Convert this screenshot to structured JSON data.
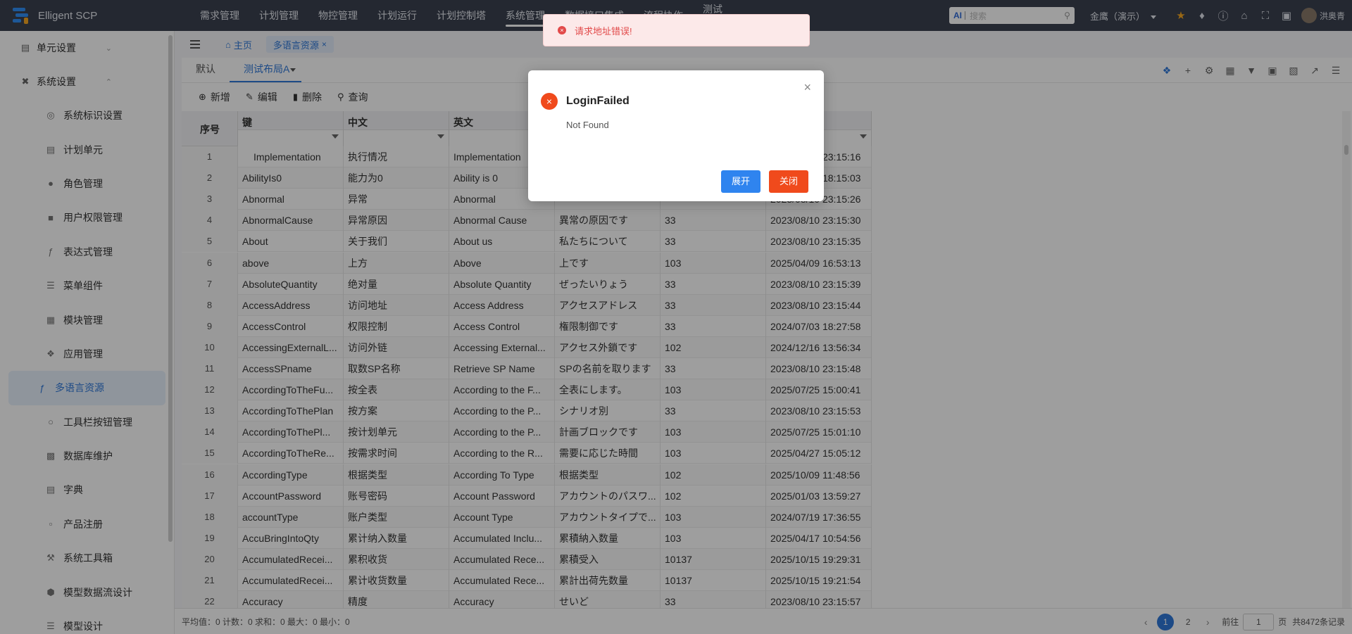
{
  "app": {
    "title": "Elligent SCP"
  },
  "topnav": [
    "需求管理",
    "计划管理",
    "物控管理",
    "计划运行",
    "计划控制塔",
    "系统管理",
    "数据接口集成",
    "流程协作",
    "测试"
  ],
  "topbar": {
    "search_placeholder": "搜索",
    "ai_label": "AI",
    "tenant": "金鹰（演示）",
    "user": "洪奥青"
  },
  "sidebar": {
    "groups": [
      {
        "label": "单元设置",
        "icon": "unit-icon"
      },
      {
        "label": "系统设置",
        "icon": "wrench-icon"
      }
    ],
    "items": [
      {
        "label": "系统标识设置",
        "icon": "target-icon"
      },
      {
        "label": "计划单元",
        "icon": "doc-icon"
      },
      {
        "label": "角色管理",
        "icon": "person-icon"
      },
      {
        "label": "用户权限管理",
        "icon": "lock-icon"
      },
      {
        "label": "表达式管理",
        "icon": "fx-icon"
      },
      {
        "label": "菜单组件",
        "icon": "list-icon"
      },
      {
        "label": "模块管理",
        "icon": "table-icon"
      },
      {
        "label": "应用管理",
        "icon": "apps-icon"
      },
      {
        "label": "多语言资源",
        "icon": "fx-icon"
      },
      {
        "label": "工具栏按钮管理",
        "icon": "bulb-icon"
      },
      {
        "label": "数据库维护",
        "icon": "db-icon"
      },
      {
        "label": "字典",
        "icon": "book-icon"
      },
      {
        "label": "产品注册",
        "icon": "reg-icon"
      },
      {
        "label": "系统工具箱",
        "icon": "tool-icon"
      },
      {
        "label": "模型数据流设计",
        "icon": "cube-icon"
      },
      {
        "label": "模型设计",
        "icon": "layers-icon"
      }
    ]
  },
  "pagetabs": {
    "home": "主页",
    "current": "多语言资源"
  },
  "layouttabs": [
    "默认",
    "测试布局A"
  ],
  "toolbar": {
    "add": "新增",
    "edit": "编辑",
    "delete": "删除",
    "query": "查询"
  },
  "grid": {
    "headers": [
      "序号",
      "键",
      "中文",
      "英文",
      "",
      "",
      ""
    ],
    "rows": [
      [
        "1",
        "Implementation",
        "执行情况",
        "Implementation",
        "",
        "",
        "2023/08/10 23:15:16"
      ],
      [
        "2",
        "AbilityIs0",
        "能力为0",
        "Ability is 0",
        "",
        "",
        "2023/08/10 18:15:03"
      ],
      [
        "3",
        "Abnormal",
        "异常",
        "Abnormal",
        "",
        "",
        "2023/08/10 23:15:26"
      ],
      [
        "4",
        "AbnormalCause",
        "异常原因",
        "Abnormal Cause",
        "異常の原因です",
        "33",
        "2023/08/10 23:15:30"
      ],
      [
        "5",
        "About",
        "关于我们",
        "About us",
        "私たちについて",
        "33",
        "2023/08/10 23:15:35"
      ],
      [
        "6",
        "above",
        "上方",
        "Above",
        "上です",
        "103",
        "2025/04/09 16:53:13"
      ],
      [
        "7",
        "AbsoluteQuantity",
        "绝对量",
        "Absolute Quantity",
        "ぜったいりょう",
        "33",
        "2023/08/10 23:15:39"
      ],
      [
        "8",
        "AccessAddress",
        "访问地址",
        "Access Address",
        "アクセスアドレス",
        "33",
        "2023/08/10 23:15:44"
      ],
      [
        "9",
        "AccessControl",
        "权限控制",
        "Access Control",
        "権限制御です",
        "33",
        "2024/07/03 18:27:58"
      ],
      [
        "10",
        "AccessingExternalL...",
        "访问外链",
        "Accessing External...",
        "アクセス外鎖です",
        "102",
        "2024/12/16 13:56:34"
      ],
      [
        "11",
        "AccessSPname",
        "取数SP名称",
        "Retrieve SP Name",
        "SPの名前を取ります",
        "33",
        "2023/08/10 23:15:48"
      ],
      [
        "12",
        "AccordingToTheFu...",
        "按全表",
        "According to the F...",
        "全表にします。",
        "103",
        "2025/07/25 15:00:41"
      ],
      [
        "13",
        "AccordingToThePlan",
        "按方案",
        "According to the P...",
        "シナリオ別",
        "33",
        "2023/08/10 23:15:53"
      ],
      [
        "14",
        "AccordingToThePl...",
        "按计划单元",
        "According to the P...",
        "計画ブロックです",
        "103",
        "2025/07/25 15:01:10"
      ],
      [
        "15",
        "AccordingToTheRe...",
        "按需求时间",
        "According to the R...",
        "需要に応じた時間",
        "103",
        "2025/04/27 15:05:12"
      ],
      [
        "16",
        "AccordingType",
        "根据类型",
        "According To Type",
        "根据类型",
        "102",
        "2025/10/09 11:48:56"
      ],
      [
        "17",
        "AccountPassword",
        "账号密码",
        "Account Password",
        "アカウントのパスワ...",
        "102",
        "2025/01/03 13:59:27"
      ],
      [
        "18",
        "accountType",
        "账户类型",
        "Account Type",
        "アカウントタイプで...",
        "103",
        "2024/07/19 17:36:55"
      ],
      [
        "19",
        "AccuBringIntoQty",
        "累计纳入数量",
        "Accumulated Inclu...",
        "累積納入数量",
        "103",
        "2025/04/17 10:54:56"
      ],
      [
        "20",
        "AccumulatedRecei...",
        "累积收货",
        "Accumulated Rece...",
        "累積受入",
        "10137",
        "2025/10/15 19:29:31"
      ],
      [
        "21",
        "AccumulatedRecei...",
        "累计收货数量",
        "Accumulated Rece...",
        "累計出荷先数量",
        "10137",
        "2025/10/15 19:21:54"
      ],
      [
        "22",
        "Accuracy",
        "精度",
        "Accuracy",
        "せいど",
        "33",
        "2023/08/10 23:15:57"
      ]
    ]
  },
  "footer": {
    "stats": "平均值：0 计数：0 求和：0 最大：0 最小：0",
    "pages": [
      "1",
      "2"
    ],
    "goto_label": "前往",
    "goto_value": "1",
    "page_unit": "页",
    "total": "共8472条记录"
  },
  "toast": {
    "message": "请求地址错误!"
  },
  "modal": {
    "title": "LoginFailed",
    "message": "Not Found",
    "expand": "展开",
    "close": "关闭"
  }
}
